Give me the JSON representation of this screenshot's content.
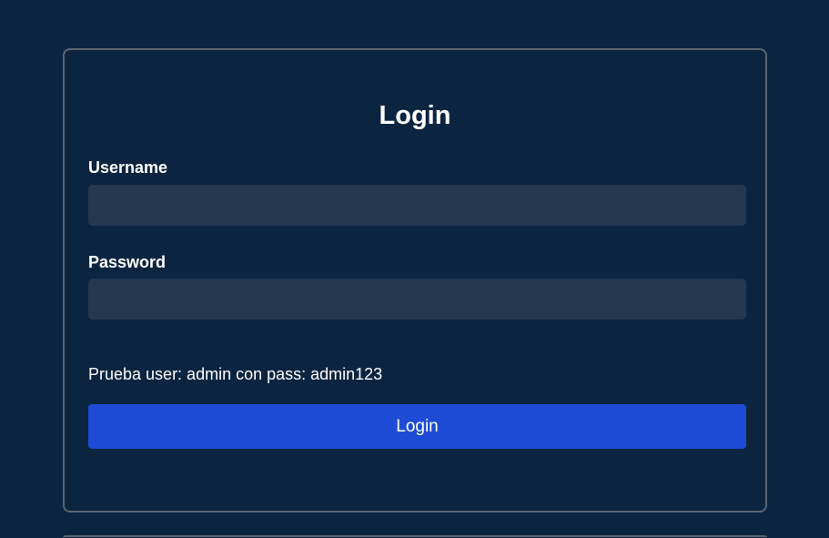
{
  "login_form": {
    "title": "Login",
    "username": {
      "label": "Username",
      "value": "",
      "placeholder": ""
    },
    "password": {
      "label": "Password",
      "value": "",
      "placeholder": ""
    },
    "hint": "Prueba user: admin con pass: admin123",
    "submit_label": "Login"
  },
  "colors": {
    "background": "#0b2541",
    "input_background": "#243850",
    "button": "#1e4bd6",
    "border": "#5b6673",
    "text": "#ffffff"
  }
}
